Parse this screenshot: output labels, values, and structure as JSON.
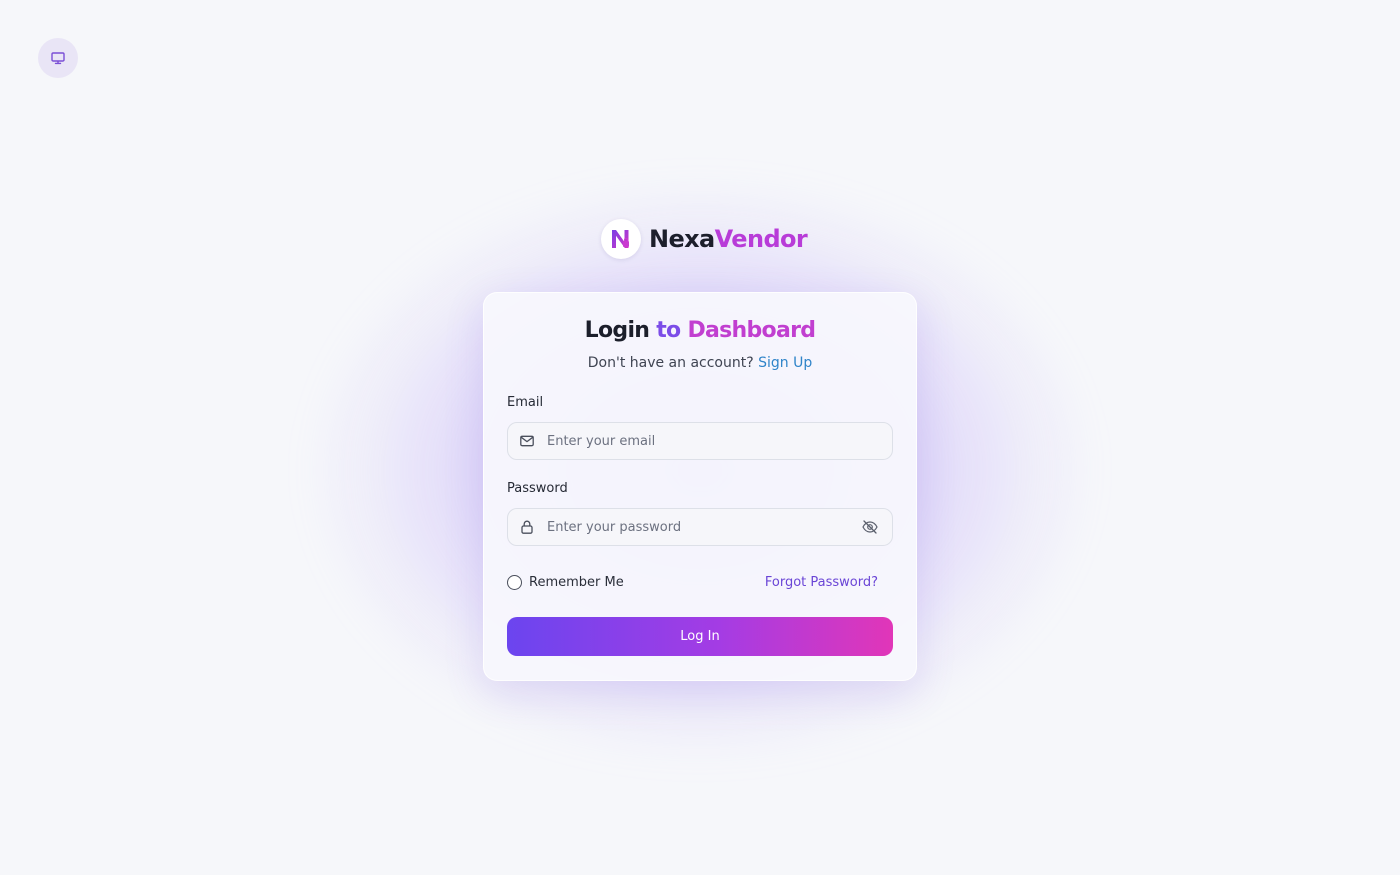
{
  "brand": {
    "name_part1": "Nexa",
    "name_part2": "Vendor",
    "logo_letter": "N",
    "logo_icon": "nexavendor-logo-icon"
  },
  "device_toggle": {
    "icon": "monitor-icon"
  },
  "login": {
    "title_part1": "Login",
    "title_part2": "to",
    "title_part3": "Dashboard",
    "prompt": "Don't have an account?",
    "signup_link": "Sign Up",
    "email_label": "Email",
    "email_placeholder": "Enter your email",
    "email_value": "",
    "email_icon": "mail-icon",
    "password_label": "Password",
    "password_placeholder": "Enter your password",
    "password_value": "",
    "password_icon": "lock-icon",
    "visibility_icon": "eye-off-icon",
    "remember_label": "Remember Me",
    "remember_checked": false,
    "forgot_link": "Forgot Password?",
    "submit_label": "Log In"
  },
  "colors": {
    "background": "#f6f7fa",
    "brand_purple": "#7c4de8",
    "brand_magenta": "#c13fd0",
    "link_blue": "#2f84c9",
    "forgot_purple": "#6a45d6",
    "button_gradient_start": "#6b45ef",
    "button_gradient_end": "#e136b8"
  }
}
